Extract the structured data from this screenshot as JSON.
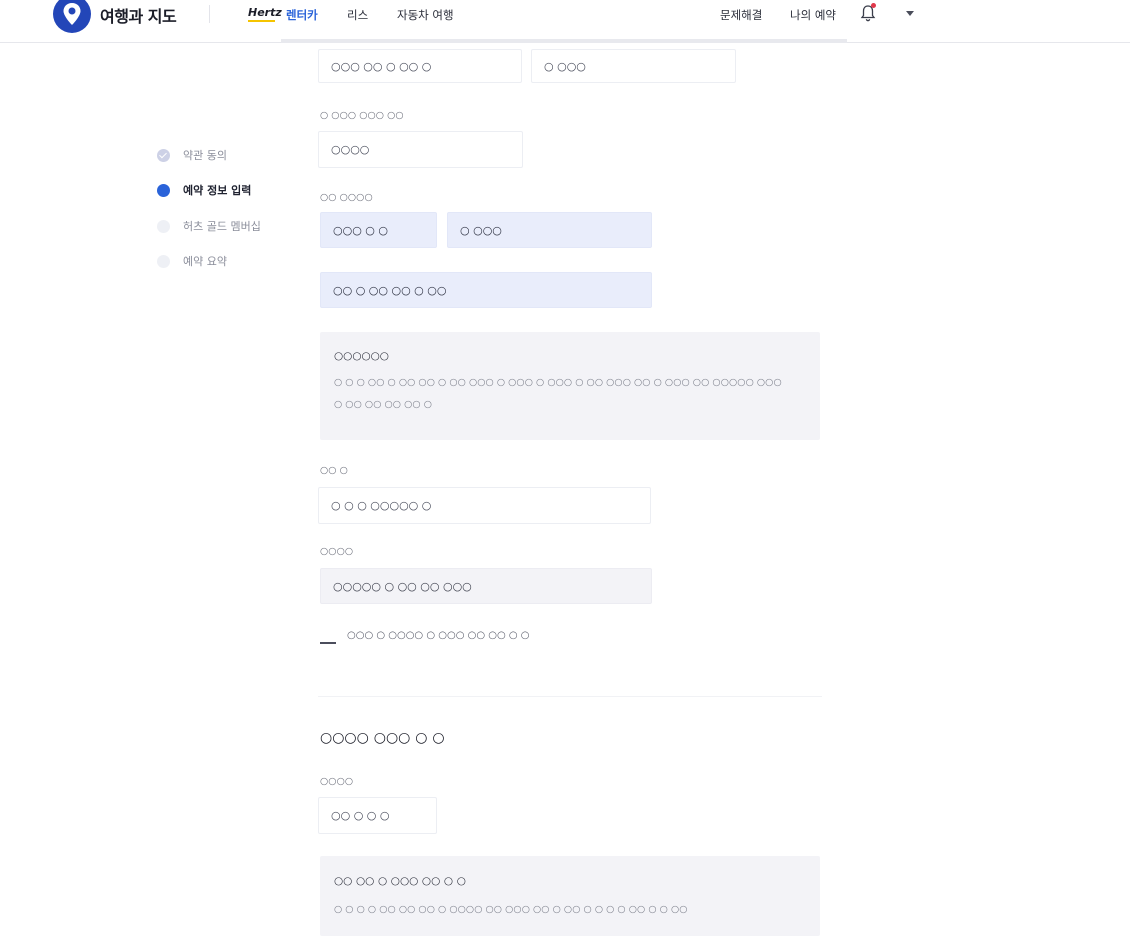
{
  "header": {
    "brand": "여행과 지도",
    "partner": "Hertz",
    "nav": [
      "렌터카",
      "리스",
      "자동차 여행"
    ],
    "right": [
      "문제해결",
      "나의 예약"
    ]
  },
  "colors": {
    "accent": "#2a63d9",
    "hertz_yellow": "#f5c400",
    "notification": "#e0384b"
  },
  "steps": [
    {
      "label": "약관 동의",
      "state": "done"
    },
    {
      "label": "예약 정보 입력",
      "state": "current"
    },
    {
      "label": "허츠 골드 멤버십",
      "state": "todo"
    },
    {
      "label": "예약 요약",
      "state": "todo"
    }
  ],
  "form": {
    "top_field_1": "○○○ ○○ ○ ○○ ○",
    "top_field_2": "○ ○○○",
    "field_a_label": "○ ○○○ ○○○ ○○",
    "field_a_value": "○○○○",
    "group_label": "○○ ○○○○",
    "group_value_1": "○○○ ○ ○",
    "group_value_2": "○ ○○○",
    "group_value_3": "○○ ○ ○○ ○○ ○ ○○",
    "notice_title": "○○○○○○",
    "notice_line_1": "○ ○ ○ ○○ ○ ○○ ○○ ○ ○○ ○○○ ○ ○○○ ○ ○○○ ○ ○○ ○○○ ○○ ○ ○○○ ○○ ○○○○○ ○○○",
    "notice_line_2": "○ ○○ ○○ ○○ ○○ ○",
    "field_b_label": "○○ ○",
    "field_b_value": "○ ○ ○ ○○○○○ ○",
    "field_c_label": "○○○○",
    "field_c_value": "○○○○○ ○ ○○ ○○ ○○○",
    "checkbox_label": "○○○ ○ ○○○○ ○ ○○○ ○○ ○○ ○ ○"
  },
  "section2": {
    "title": "○○○○ ○○○ ○ ○",
    "field_label": "○○○○",
    "field_value": "○○ ○ ○ ○",
    "notice_title": "○○ ○○ ○ ○○○ ○○ ○ ○",
    "notice_line_1": "○ ○ ○ ○ ○○ ○○ ○○ ○ ○○○○ ○○ ○○○ ○○ ○ ○○ ○ ○ ○ ○ ○○ ○ ○ ○○"
  }
}
